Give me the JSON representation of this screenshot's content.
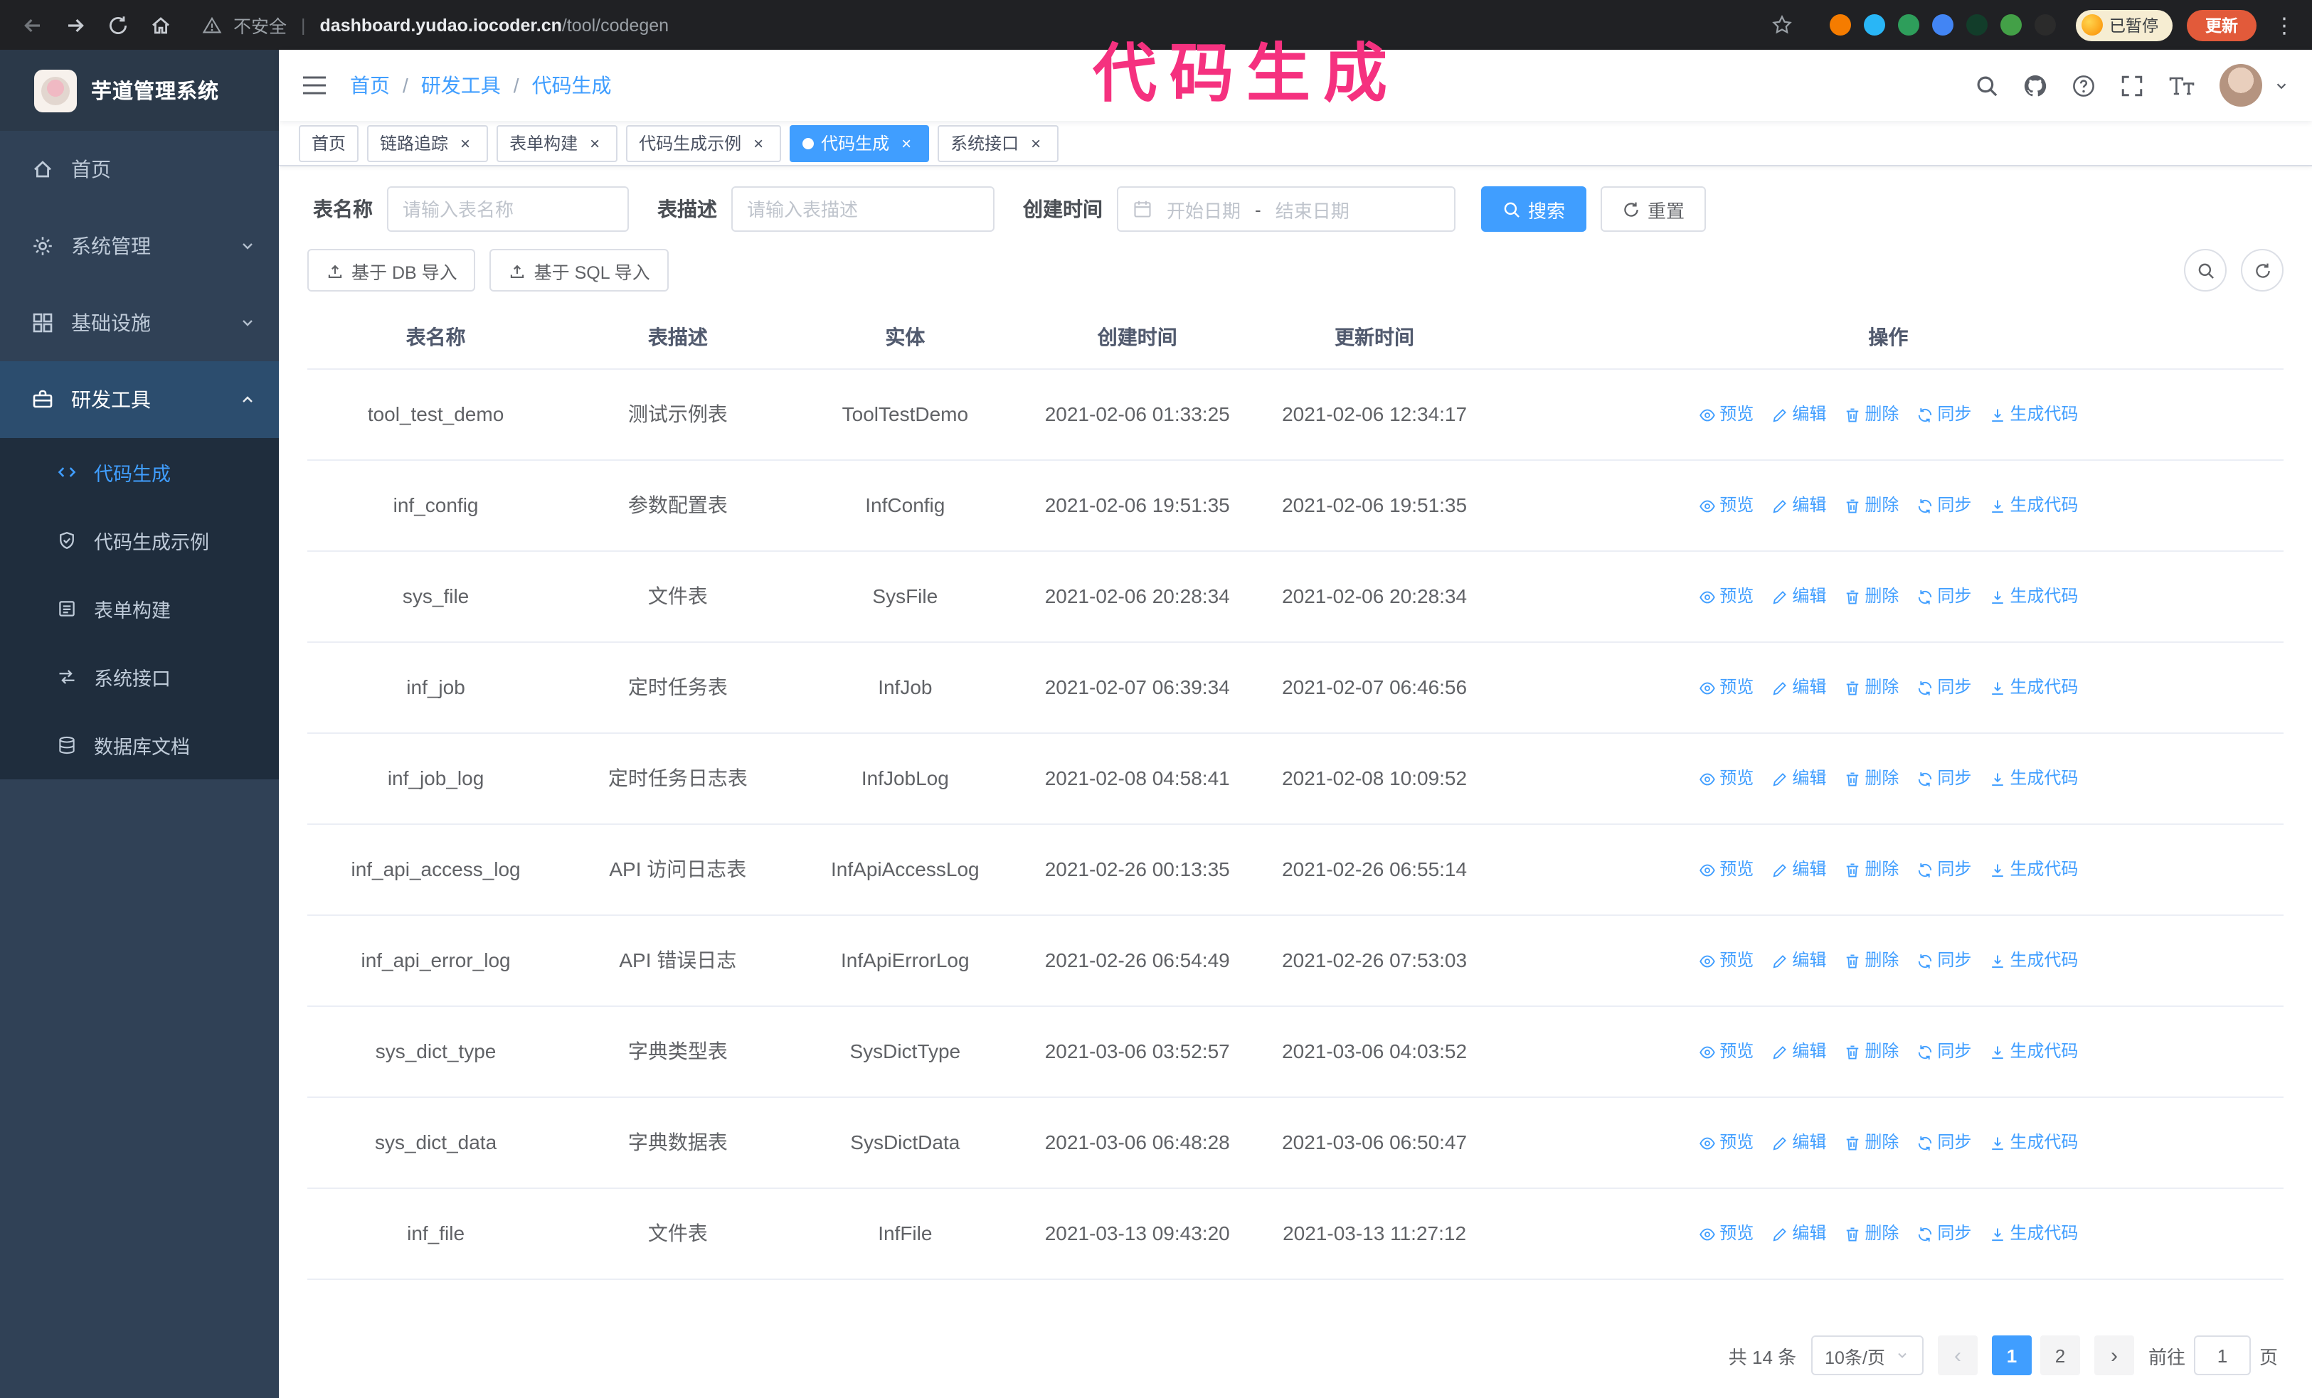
{
  "theme": {
    "accent": "#409eff",
    "annotation": "#f5317f",
    "sidebar_bg": "#304156",
    "submenu_bg": "#1f2d3d",
    "active_parent_bg": "#2c4d6e"
  },
  "annotation": {
    "text": "代码生成"
  },
  "browser": {
    "security_label": "不安全",
    "url_host": "dashboard.yudao.iocoder.cn",
    "url_path": "/tool/codegen",
    "paused_badge": "已暂停",
    "update_button": "更新",
    "extension_colors": [
      "#f57c00",
      "#29b6f6",
      "#2e9e5b",
      "#4285f4",
      "#123d2a",
      "#43a047",
      "#2b2b2b"
    ]
  },
  "sidebar": {
    "logo_title": "芋道管理系统",
    "items": [
      {
        "id": "home",
        "icon": "home",
        "label": "首页"
      },
      {
        "id": "system",
        "icon": "gear",
        "label": "系统管理",
        "expandable": true
      },
      {
        "id": "infra",
        "icon": "infra",
        "label": "基础设施",
        "expandable": true
      },
      {
        "id": "devtools",
        "icon": "tools",
        "label": "研发工具",
        "expanded": true
      }
    ],
    "subitems": [
      {
        "id": "codegen",
        "icon": "code",
        "label": "代码生成",
        "active": true
      },
      {
        "id": "codegen-example",
        "icon": "example",
        "label": "代码生成示例"
      },
      {
        "id": "form-builder",
        "icon": "form",
        "label": "表单构建"
      },
      {
        "id": "api",
        "icon": "api",
        "label": "系统接口"
      },
      {
        "id": "db-doc",
        "icon": "db",
        "label": "数据库文档"
      }
    ]
  },
  "header": {
    "breadcrumb": [
      "首页",
      "研发工具",
      "代码生成"
    ],
    "separator": "/"
  },
  "tabs": [
    {
      "label": "首页",
      "closable": false,
      "active": false
    },
    {
      "label": "链路追踪",
      "closable": true,
      "active": false
    },
    {
      "label": "表单构建",
      "closable": true,
      "active": false
    },
    {
      "label": "代码生成示例",
      "closable": true,
      "active": false
    },
    {
      "label": "代码生成",
      "closable": true,
      "active": true
    },
    {
      "label": "系统接口",
      "closable": true,
      "active": false
    }
  ],
  "filters": {
    "table_name_label": "表名称",
    "table_name_placeholder": "请输入表名称",
    "table_desc_label": "表描述",
    "table_desc_placeholder": "请输入表描述",
    "create_time_label": "创建时间",
    "date_start_placeholder": "开始日期",
    "date_separator": "-",
    "date_end_placeholder": "结束日期",
    "search_button": "搜索",
    "reset_button": "重置"
  },
  "toolbar": {
    "import_db": "基于 DB 导入",
    "import_sql": "基于 SQL 导入"
  },
  "table": {
    "columns": [
      "表名称",
      "表描述",
      "实体",
      "创建时间",
      "更新时间",
      "操作"
    ],
    "actions": [
      "预览",
      "编辑",
      "删除",
      "同步",
      "生成代码"
    ],
    "rows": [
      {
        "name": "tool_test_demo",
        "desc": "测试示例表",
        "entity": "ToolTestDemo",
        "created": "2021-02-06 01:33:25",
        "updated": "2021-02-06 12:34:17"
      },
      {
        "name": "inf_config",
        "desc": "参数配置表",
        "entity": "InfConfig",
        "created": "2021-02-06 19:51:35",
        "updated": "2021-02-06 19:51:35"
      },
      {
        "name": "sys_file",
        "desc": "文件表",
        "entity": "SysFile",
        "created": "2021-02-06 20:28:34",
        "updated": "2021-02-06 20:28:34"
      },
      {
        "name": "inf_job",
        "desc": "定时任务表",
        "entity": "InfJob",
        "created": "2021-02-07 06:39:34",
        "updated": "2021-02-07 06:46:56"
      },
      {
        "name": "inf_job_log",
        "desc": "定时任务日志表",
        "entity": "InfJobLog",
        "created": "2021-02-08 04:58:41",
        "updated": "2021-02-08 10:09:52"
      },
      {
        "name": "inf_api_access_log",
        "desc": "API 访问日志表",
        "entity": "InfApiAccessLog",
        "created": "2021-02-26 00:13:35",
        "updated": "2021-02-26 06:55:14"
      },
      {
        "name": "inf_api_error_log",
        "desc": "API 错误日志",
        "entity": "InfApiErrorLog",
        "created": "2021-02-26 06:54:49",
        "updated": "2021-02-26 07:53:03"
      },
      {
        "name": "sys_dict_type",
        "desc": "字典类型表",
        "entity": "SysDictType",
        "created": "2021-03-06 03:52:57",
        "updated": "2021-03-06 04:03:52"
      },
      {
        "name": "sys_dict_data",
        "desc": "字典数据表",
        "entity": "SysDictData",
        "created": "2021-03-06 06:48:28",
        "updated": "2021-03-06 06:50:47"
      },
      {
        "name": "inf_file",
        "desc": "文件表",
        "entity": "InfFile",
        "created": "2021-03-13 09:43:20",
        "updated": "2021-03-13 11:27:12"
      }
    ]
  },
  "pagination": {
    "total": "共 14 条",
    "page_size": "10条/页",
    "pages": [
      "1",
      "2"
    ],
    "active_page": "1",
    "goto_label": "前往",
    "goto_value": "1",
    "goto_suffix": "页"
  }
}
